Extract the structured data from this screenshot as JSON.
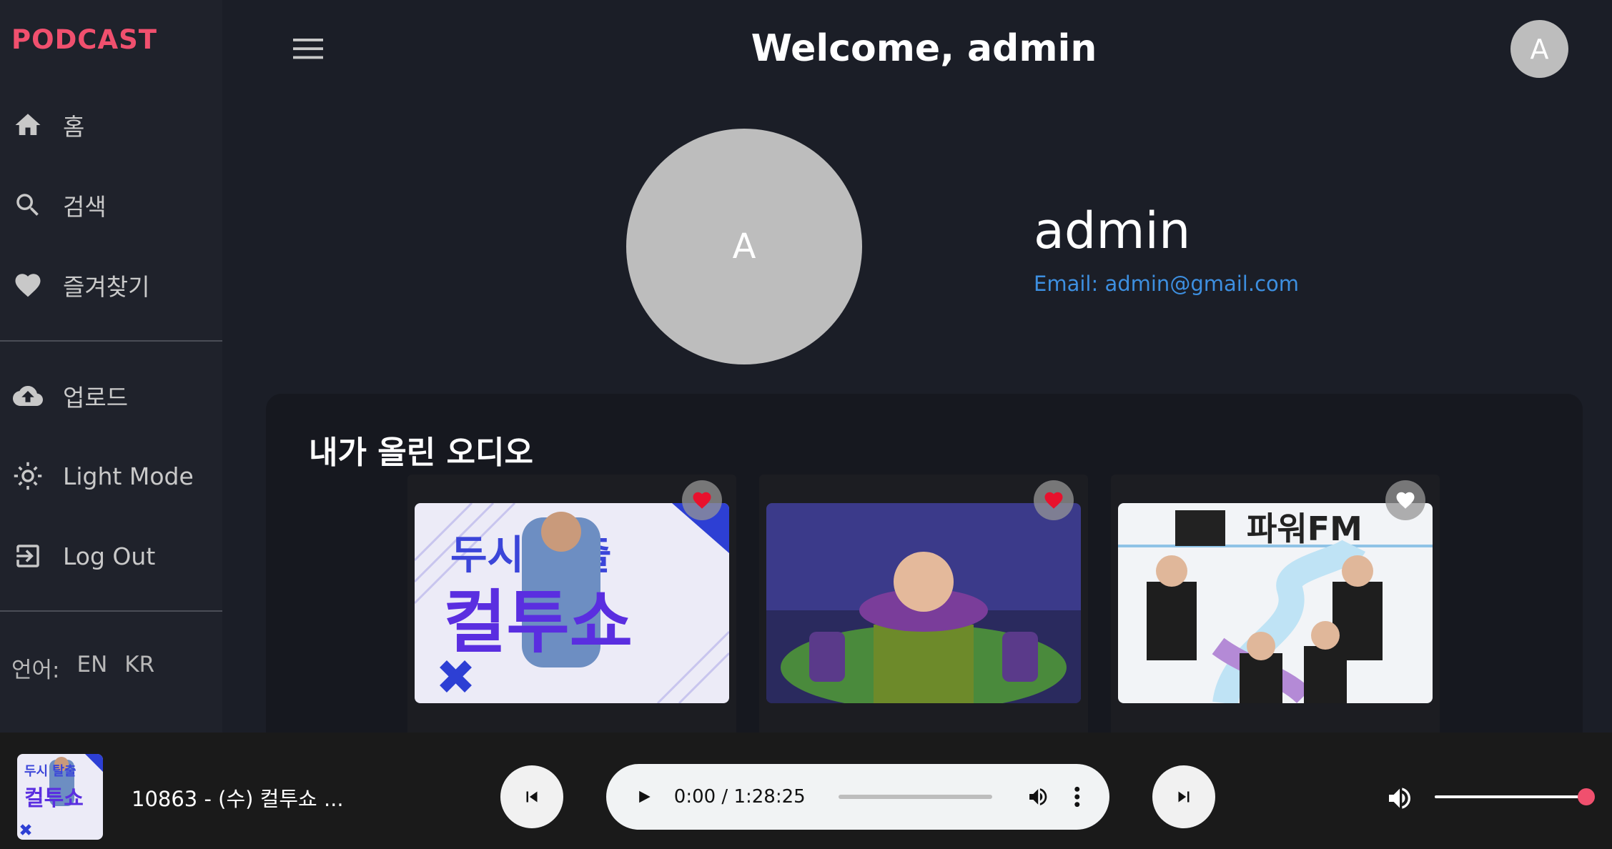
{
  "app": {
    "logo": "PODCAST",
    "accent_color": "#f0506e",
    "link_color": "#3d8fe0"
  },
  "sidebar": {
    "items": [
      {
        "label": "홈",
        "icon": "home-icon"
      },
      {
        "label": "검색",
        "icon": "search-icon"
      },
      {
        "label": "즐겨찾기",
        "icon": "heart-icon"
      },
      {
        "label": "업로드",
        "icon": "cloud-upload-icon"
      },
      {
        "label": "Light Mode",
        "icon": "sun-icon"
      },
      {
        "label": "Log Out",
        "icon": "logout-icon"
      }
    ],
    "language": {
      "label": "언어:",
      "options": [
        "EN",
        "KR"
      ]
    }
  },
  "header": {
    "title": "Welcome, admin",
    "avatar_initial": "A"
  },
  "profile": {
    "avatar_initial": "A",
    "name": "admin",
    "email": "Email: admin@gmail.com"
  },
  "uploads": {
    "title": "내가 올린 오디오",
    "cards": [
      {
        "favorited": true,
        "thumb_text_top": "두시 탈출",
        "thumb_text_main": "컬투쇼"
      },
      {
        "favorited": true,
        "thumb_text_top": ""
      },
      {
        "favorited": false,
        "thumb_text_top": "파워FM"
      }
    ]
  },
  "player": {
    "now_playing_title": "10863 - (수) 컬투쇼 ...",
    "time": "0:00 / 1:28:25",
    "volume": 1.0
  }
}
